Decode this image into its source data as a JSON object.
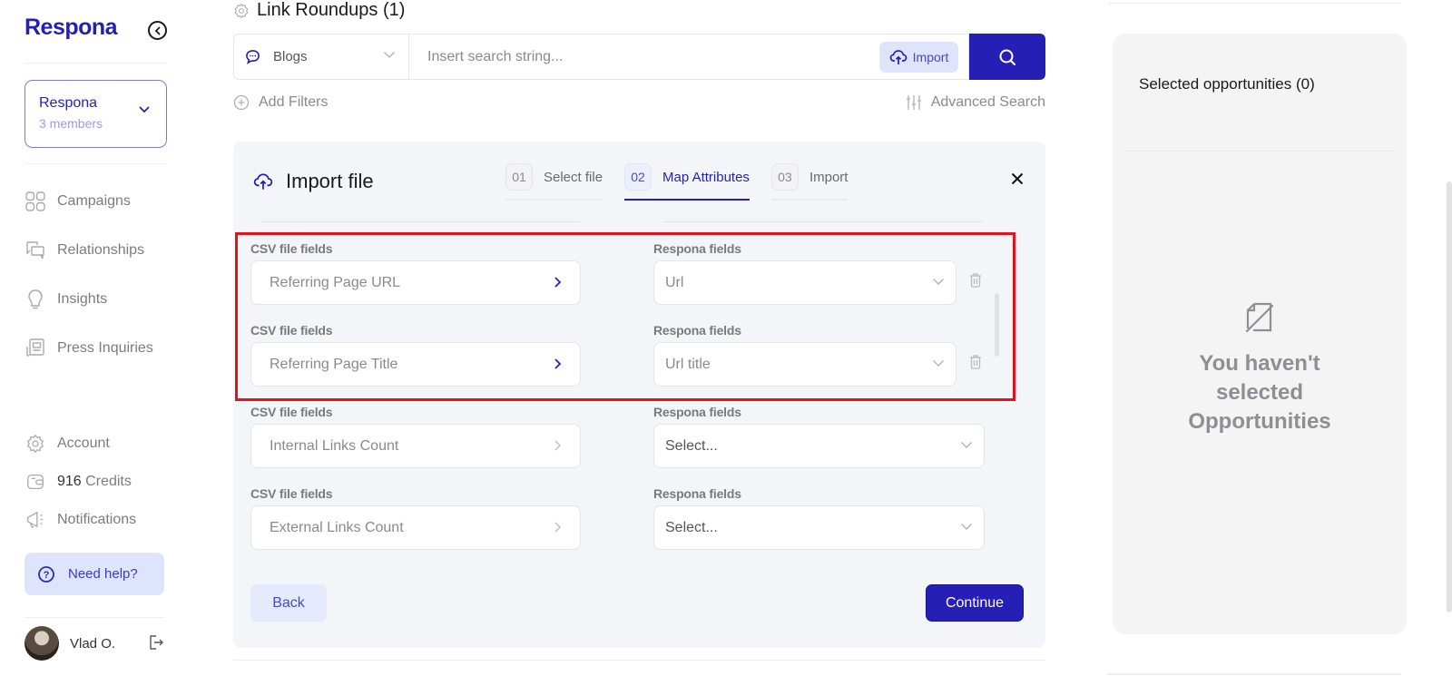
{
  "sidebar": {
    "logo": "Respona",
    "workspace": {
      "name": "Respona",
      "members": "3 members"
    },
    "nav": [
      {
        "label": "Campaigns",
        "icon": "grid-icon"
      },
      {
        "label": "Relationships",
        "icon": "chat-bubbles-icon"
      },
      {
        "label": "Insights",
        "icon": "lightbulb-icon"
      },
      {
        "label": "Press Inquiries",
        "icon": "newspaper-icon"
      }
    ],
    "account_label": "Account",
    "credits_count": "916",
    "credits_label": "Credits",
    "notifications_label": "Notifications",
    "help_label": "Need help?",
    "user_name": "Vlad O."
  },
  "main": {
    "title": "Link Roundups (1)",
    "source_select": "Blogs",
    "search_placeholder": "Insert search string...",
    "import_label": "Import",
    "add_filters_label": "Add Filters",
    "advanced_search_label": "Advanced Search"
  },
  "import_panel": {
    "title": "Import file",
    "steps": [
      {
        "num": "01",
        "label": "Select file",
        "active": false
      },
      {
        "num": "02",
        "label": "Map Attributes",
        "active": true
      },
      {
        "num": "03",
        "label": "Import",
        "active": false
      }
    ],
    "csv_label": "CSV file fields",
    "respona_label": "Respona fields",
    "mappings": [
      {
        "csv": "Referring Page URL",
        "respona": "Url",
        "mapped": true
      },
      {
        "csv": "Referring Page Title",
        "respona": "Url title",
        "mapped": true
      },
      {
        "csv": "Internal Links Count",
        "respona": "Select...",
        "mapped": false
      },
      {
        "csv": "External Links Count",
        "respona": "Select...",
        "mapped": false
      }
    ],
    "back_label": "Back",
    "continue_label": "Continue"
  },
  "right_panel": {
    "title": "Selected opportunities (0)",
    "empty_line1": "You haven't",
    "empty_line2": "selected",
    "empty_line3": "Opportunities"
  },
  "colors": {
    "brand": "#251fb6",
    "highlight": "#e3131d",
    "pill_bg": "#dde4fc"
  }
}
